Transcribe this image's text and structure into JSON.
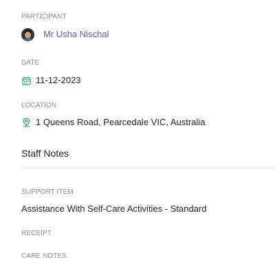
{
  "participant": {
    "label": "PARTICIPANT",
    "name": "Mr Usha Nischal"
  },
  "date": {
    "label": "DATE",
    "value": "11-12-2023",
    "icon": "calendar-icon"
  },
  "location": {
    "label": "LOCATION",
    "value": "1 Queens Road, Pearcedale VIC, Australia",
    "icon": "location-pin-icon"
  },
  "staff_notes": {
    "title": "Staff Notes"
  },
  "support_item": {
    "label": "SUPPORT ITEM",
    "value": "Assistance With Self-Care Activities - Standard"
  },
  "receipt": {
    "label": "RECEIPT"
  },
  "care_notes": {
    "label": "CARE NOTES"
  },
  "colors": {
    "accent": "#6b54c8",
    "icon_green": "#2aa06a",
    "label_gray": "#8a8f9a"
  }
}
